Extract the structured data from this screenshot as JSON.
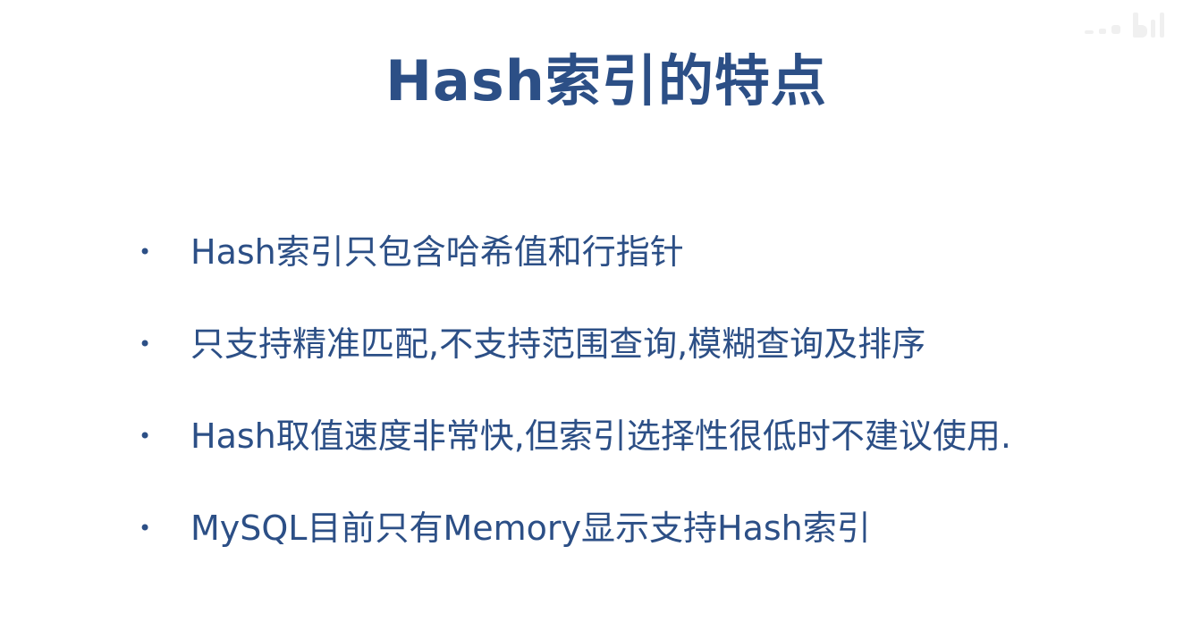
{
  "slide": {
    "title": "Hash索引的特点",
    "bullet_symbol": "•",
    "bullets": [
      "Hash索引只包含哈希值和行指针",
      "只支持精准匹配,不支持范围查询,模糊查询及排序",
      "Hash取值速度非常快,但索引选择性很低时不建议使用.",
      "MySQL目前只有Memory显示支持Hash索引"
    ]
  },
  "colors": {
    "text": "#2c4f86",
    "background": "#ffffff"
  }
}
